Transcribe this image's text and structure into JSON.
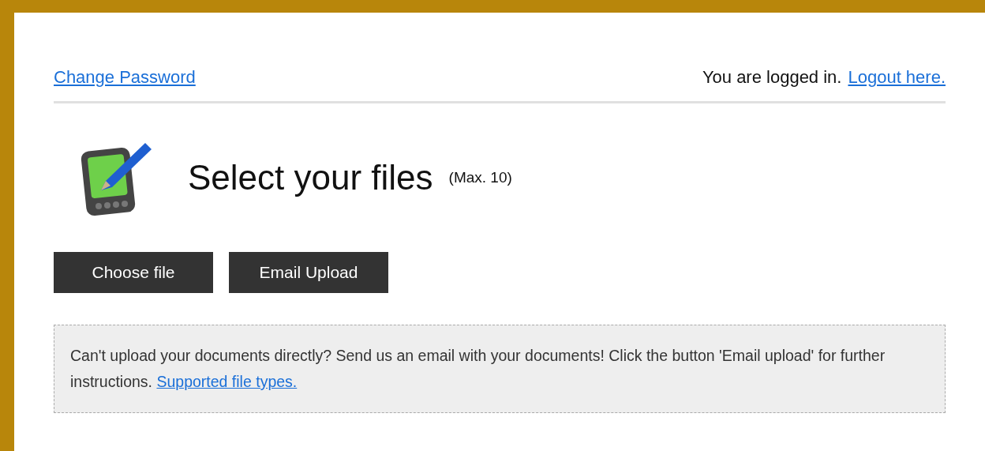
{
  "header": {
    "change_password_link": "Change Password",
    "login_status": "You are logged in.",
    "logout_link": "Logout here."
  },
  "title": {
    "heading": "Select your files",
    "limit": "(Max. 10)"
  },
  "buttons": [
    {
      "label": "Choose file"
    },
    {
      "label": "Email Upload"
    }
  ],
  "note": {
    "text": "Can't upload your documents directly? Send us an email with your documents! Click the button 'Email upload' for further instructions.",
    "link": "Supported file types."
  }
}
